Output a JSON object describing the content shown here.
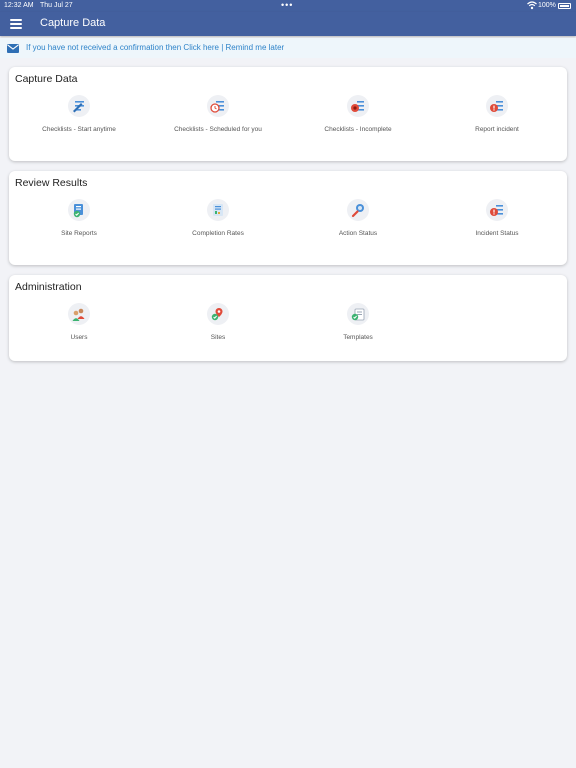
{
  "status_bar": {
    "time": "12:32 AM",
    "date": "Thu Jul 27",
    "dots": "•••",
    "battery": "100%"
  },
  "nav": {
    "title": "Capture Data"
  },
  "notice": {
    "text": "If you have not received a confirmation then Click here | Remind me later"
  },
  "sections": [
    {
      "title": "Capture Data",
      "tiles": [
        {
          "label": "Checklists - Start anytime",
          "icon": "checklist-pen-icon"
        },
        {
          "label": "Checklists - Scheduled for you",
          "icon": "checklist-clock-icon"
        },
        {
          "label": "Checklists - Incomplete",
          "icon": "checklist-incomplete-icon"
        },
        {
          "label": "Report incident",
          "icon": "report-incident-icon"
        }
      ]
    },
    {
      "title": "Review Results",
      "tiles": [
        {
          "label": "Site Reports",
          "icon": "site-reports-icon"
        },
        {
          "label": "Completion Rates",
          "icon": "completion-rates-icon"
        },
        {
          "label": "Action Status",
          "icon": "action-status-icon"
        },
        {
          "label": "Incident Status",
          "icon": "incident-status-icon"
        }
      ]
    },
    {
      "title": "Administration",
      "tiles": [
        {
          "label": "Users",
          "icon": "users-icon"
        },
        {
          "label": "Sites",
          "icon": "sites-icon"
        },
        {
          "label": "Templates",
          "icon": "templates-icon"
        }
      ]
    }
  ],
  "colors": {
    "header": "#43609f",
    "notice_text": "#2e83c9",
    "background": "#f2f3f7",
    "accent_green": "#3cb371",
    "accent_red": "#e04b3a"
  }
}
